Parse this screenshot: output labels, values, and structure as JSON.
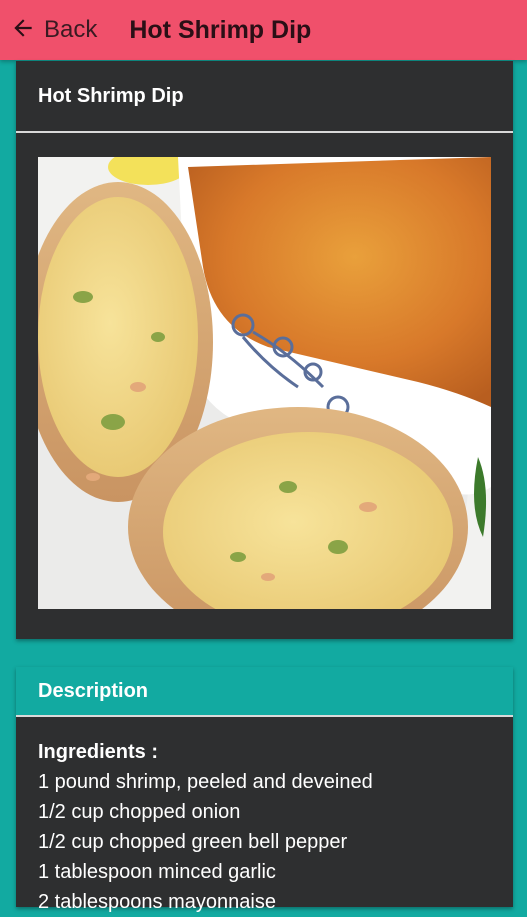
{
  "appbar": {
    "back_label": "Back",
    "title": "Hot Shrimp Dip",
    "color": "#f0506b"
  },
  "recipe_card": {
    "title": "Hot Shrimp Dip",
    "image": "hot-shrimp-dip-photo"
  },
  "description": {
    "header": "Description",
    "ingredients_heading": "Ingredients :",
    "ingredients": [
      "1 pound shrimp, peeled and deveined",
      "1/2 cup chopped onion",
      "1/2 cup chopped green bell pepper",
      "1 tablespoon minced garlic",
      "2 tablespoons mayonnaise"
    ]
  },
  "colors": {
    "background": "#12aaa1",
    "card": "#2e2f30"
  }
}
